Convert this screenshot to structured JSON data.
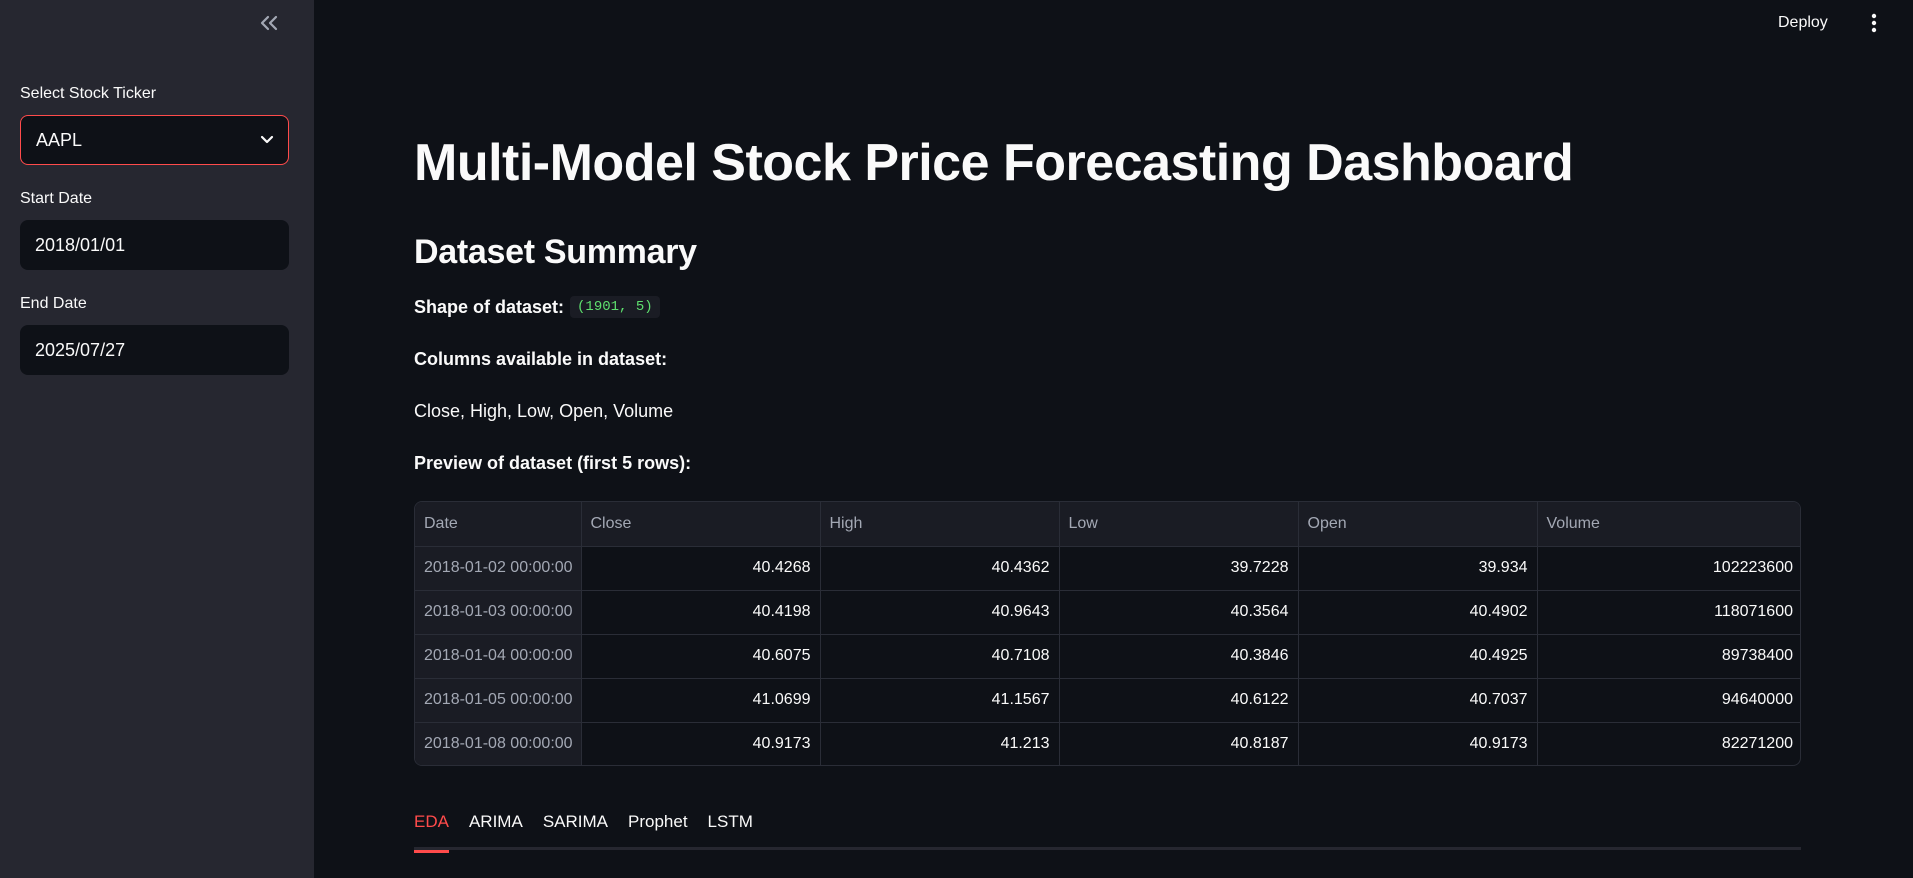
{
  "header": {
    "deploy_label": "Deploy"
  },
  "sidebar": {
    "ticker": {
      "label": "Select Stock Ticker",
      "value": "AAPL"
    },
    "start_date": {
      "label": "Start Date",
      "value": "2018/01/01"
    },
    "end_date": {
      "label": "End Date",
      "value": "2025/07/27"
    }
  },
  "main": {
    "title": "Multi-Model Stock Price Forecasting Dashboard",
    "summary_heading": "Dataset Summary",
    "shape_label": "Shape of dataset:",
    "shape_value": "(1901, 5)",
    "columns_label": "Columns available in dataset:",
    "columns_list": "Close, High, Low, Open, Volume",
    "preview_label": "Preview of dataset (first 5 rows):",
    "table": {
      "headers": [
        "Date",
        "Close",
        "High",
        "Low",
        "Open",
        "Volume"
      ],
      "rows": [
        [
          "2018-01-02 00:00:00",
          "40.4268",
          "40.4362",
          "39.7228",
          "39.934",
          "102223600"
        ],
        [
          "2018-01-03 00:00:00",
          "40.4198",
          "40.9643",
          "40.3564",
          "40.4902",
          "118071600"
        ],
        [
          "2018-01-04 00:00:00",
          "40.6075",
          "40.7108",
          "40.3846",
          "40.4925",
          "89738400"
        ],
        [
          "2018-01-05 00:00:00",
          "41.0699",
          "41.1567",
          "40.6122",
          "40.7037",
          "94640000"
        ],
        [
          "2018-01-08 00:00:00",
          "40.9173",
          "41.213",
          "40.8187",
          "40.9173",
          "82271200"
        ]
      ]
    },
    "tabs": [
      {
        "label": "EDA",
        "active": true
      },
      {
        "label": "ARIMA",
        "active": false
      },
      {
        "label": "SARIMA",
        "active": false
      },
      {
        "label": "Prophet",
        "active": false
      },
      {
        "label": "LSTM",
        "active": false
      }
    ]
  },
  "colors": {
    "accent": "#ff4b4b",
    "sidebar_bg": "#262730",
    "main_bg": "#0e1117",
    "code_text": "#5ee06e"
  },
  "icons": {
    "collapse": "double-chevron-left-icon",
    "select": "chevron-down-icon",
    "menu": "kebab-menu-icon"
  }
}
